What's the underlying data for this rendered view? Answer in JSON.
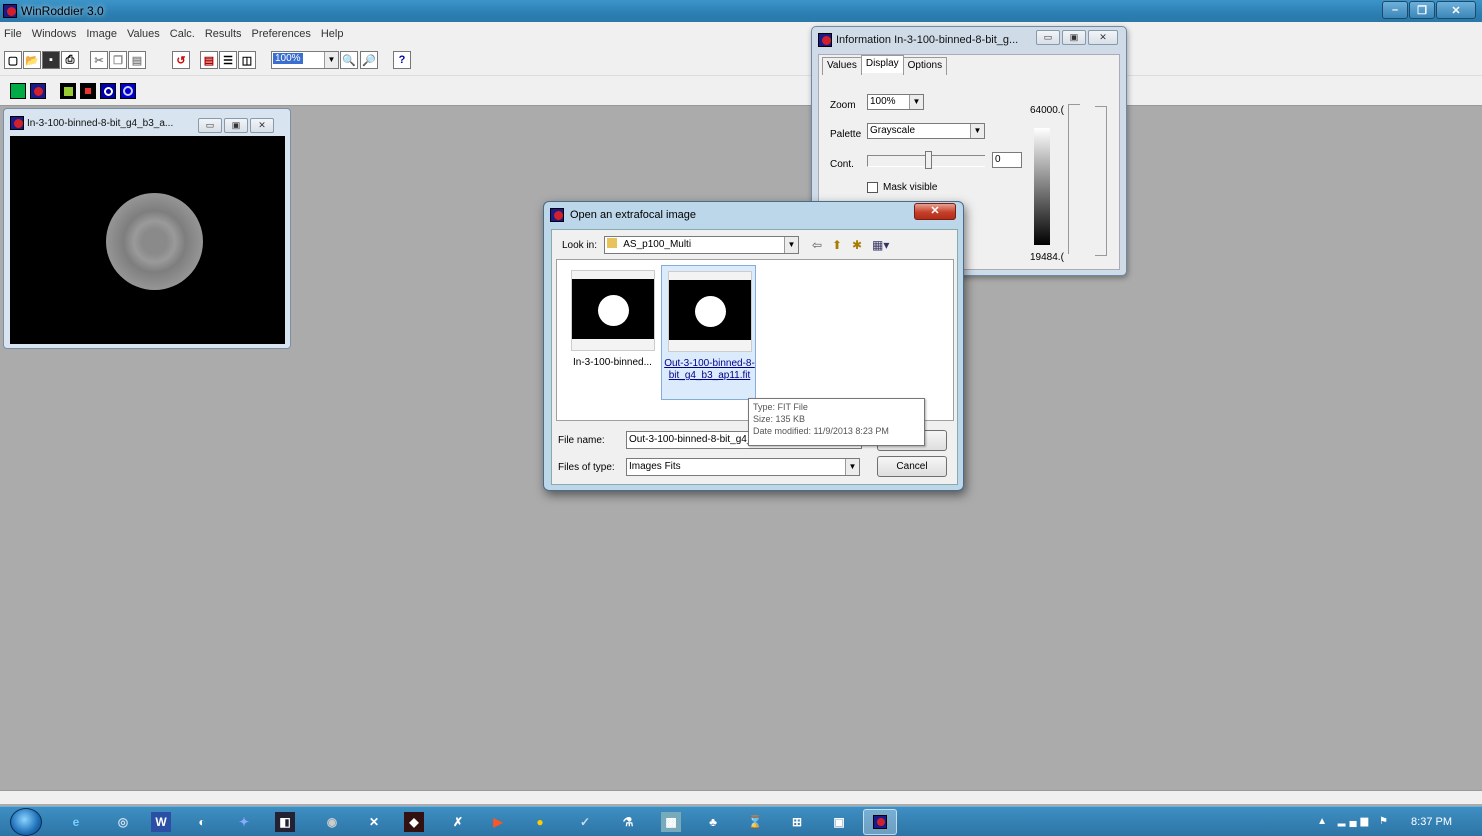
{
  "app": {
    "title": "WinRoddier 3.0"
  },
  "menu": [
    "File",
    "Windows",
    "Image",
    "Values",
    "Calc.",
    "Results",
    "Preferences",
    "Help"
  ],
  "toolbar": {
    "zoom_value": "100%",
    "help_label": "?"
  },
  "child_window": {
    "title": "In-3-100-binned-8-bit_g4_b3_a..."
  },
  "info_window": {
    "title": "Information In-3-100-binned-8-bit_g...",
    "tabs": [
      "Values",
      "Display",
      "Options"
    ],
    "zoom_label": "Zoom",
    "zoom_value": "100%",
    "palette_label": "Palette",
    "palette_value": "Grayscale",
    "cont_label": "Cont.",
    "cont_value": "0",
    "mask_label": "Mask visible",
    "max_value": "64000.(",
    "min_value": "19484.("
  },
  "open_dialog": {
    "title": "Open an extrafocal image",
    "look_in_label": "Look in:",
    "look_in_value": "AS_p100_Multi",
    "files": [
      {
        "name": "In-3-100-binned..."
      },
      {
        "name": "Out-3-100-binned-8-bit_g4_b3_ap11.fit"
      }
    ],
    "tooltip": {
      "type": "Type: FIT File",
      "size": "Size: 135 KB",
      "modified": "Date modified: 11/9/2013 8:23 PM"
    },
    "file_name_label": "File name:",
    "file_name_value": "Out-3-100-binned-8-bit_g4_b",
    "files_of_type_label": "Files of type:",
    "files_of_type_value": "Images Fits",
    "cancel_label": "Cancel",
    "open_label": ""
  },
  "taskbar": {
    "clock": "8:37 PM"
  },
  "colors": {
    "titlebar": "#2b7fb3",
    "desktop": "#ababab",
    "dialog_close": "#c4402a",
    "selection": "#dcebfc"
  }
}
